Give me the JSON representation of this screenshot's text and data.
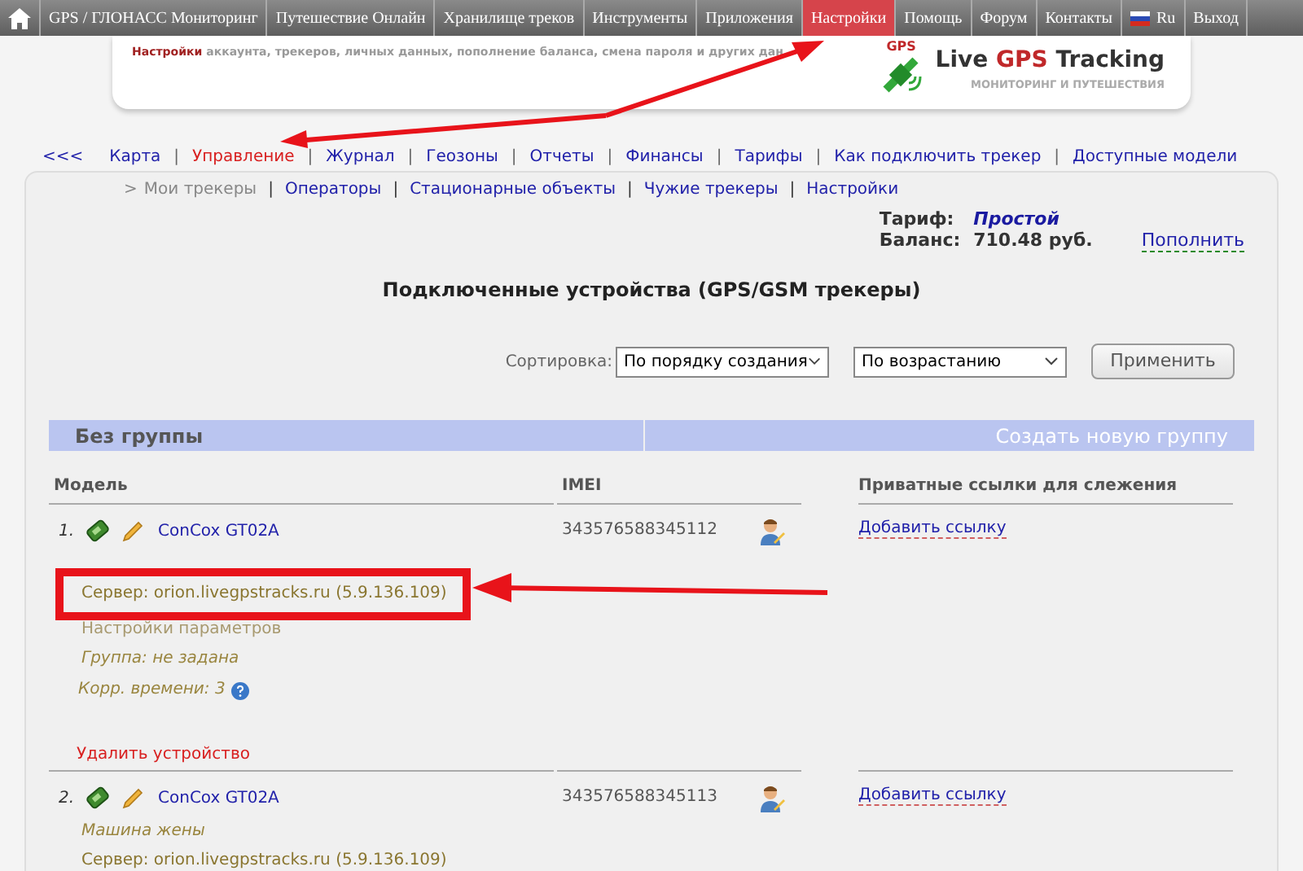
{
  "top_menu": [
    {
      "label": "GPS / ГЛОНАСС Мониторинг",
      "selected": false
    },
    {
      "label": "Путешествие Онлайн",
      "selected": false
    },
    {
      "label": "Хранилище треков",
      "selected": false
    },
    {
      "label": "Инструменты",
      "selected": false
    },
    {
      "label": "Приложения",
      "selected": false
    },
    {
      "label": "Настройки",
      "selected": true
    },
    {
      "label": "Помощь",
      "selected": false
    },
    {
      "label": "Форум",
      "selected": false
    },
    {
      "label": "Контакты",
      "selected": false
    },
    {
      "label": "Ru",
      "selected": false,
      "kind": "language"
    },
    {
      "label": "Выход",
      "selected": false
    }
  ],
  "header": {
    "lead": "Настройки",
    "description": "аккаунта, трекеров, личных данных, пополнение баланса, смена пароля и других дан",
    "logo_badge": "GPS",
    "logo_title_1": "Live",
    "logo_title_2": "GPS",
    "logo_title_3": "Tracking",
    "logo_subtitle": "МОНИТОРИНГ И ПУТЕШЕСТВИЯ"
  },
  "nav_back": "<<<",
  "nav": [
    {
      "label": "Карта",
      "selected": false
    },
    {
      "label": "Управление",
      "selected": true
    },
    {
      "label": "Журнал",
      "selected": false
    },
    {
      "label": "Геозоны",
      "selected": false
    },
    {
      "label": "Отчеты",
      "selected": false
    },
    {
      "label": "Финансы",
      "selected": false
    },
    {
      "label": "Тарифы",
      "selected": false
    },
    {
      "label": "Как подключить трекер",
      "selected": false
    },
    {
      "label": "Доступные модели",
      "selected": false
    }
  ],
  "nav_separators": [
    "|",
    "|",
    "|",
    "|",
    "|",
    "|",
    "|",
    "|"
  ],
  "subnav_marker": ">",
  "subnav": [
    {
      "label": "Мои трекеры",
      "selected": true
    },
    {
      "label": "Операторы",
      "selected": false
    },
    {
      "label": "Стационарные объекты",
      "selected": false
    },
    {
      "label": "Чужие трекеры",
      "selected": false
    },
    {
      "label": "Настройки",
      "selected": false
    }
  ],
  "subnav_separators": [
    "|",
    "|",
    "|",
    "|"
  ],
  "account": {
    "tariff_label": "Тариф:",
    "tariff": "Простой",
    "balance_label": "Баланс:",
    "balance": "710.48 руб.",
    "topup": "Пополнить"
  },
  "title": "Подключенные устройства (GPS/GSM трекеры)",
  "sort": {
    "label": "Сортировка:",
    "order": "По порядку создания",
    "direction": "По возрастанию",
    "apply": "Применить"
  },
  "group": {
    "name": "Без группы",
    "create": "Создать новую группу"
  },
  "columns": [
    "Модель",
    "IMEI",
    "Приватные ссылки для слежения"
  ],
  "devices": [
    {
      "number": "1.",
      "model": "ConCox GT02A",
      "imei": "343576588345112",
      "link": "Добавить ссылку",
      "highlighted": true,
      "details": [
        {
          "kind": "server",
          "text": "Сервер: orion.livegpstracks.ru (5.9.136.109)"
        },
        {
          "kind": "settings",
          "text": "Настройки параметров"
        },
        {
          "kind": "italic",
          "text": "Группа: не задана"
        },
        {
          "kind": "time",
          "text": "Корр. времени: 3"
        }
      ],
      "delete": "Удалить устройство"
    },
    {
      "number": "2.",
      "model": "ConCox GT02A",
      "imei": "343576588345113",
      "link": "Добавить ссылку",
      "highlighted": false,
      "details": [
        {
          "kind": "italic",
          "text": "Машина жены"
        },
        {
          "kind": "server",
          "text": "Сервер: orion.livegpstracks.ru (5.9.136.109)"
        }
      ]
    }
  ]
}
